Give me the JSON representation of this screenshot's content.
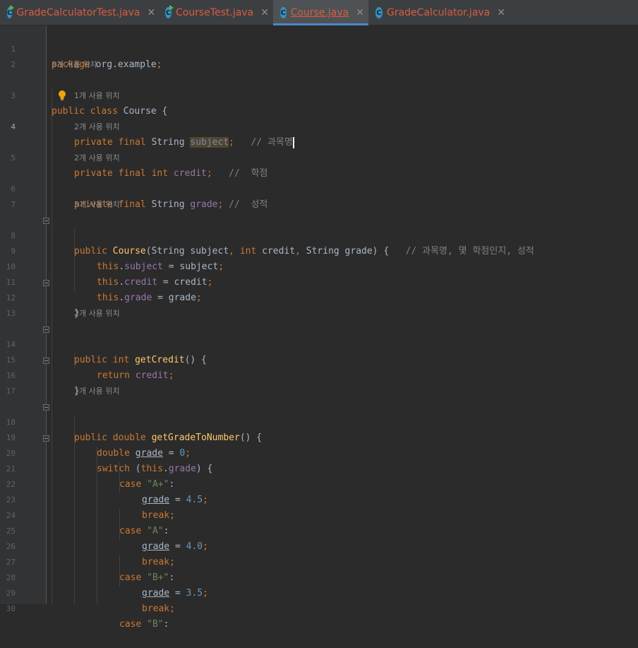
{
  "tabs": [
    {
      "name": "GradeCalculatorTest.java",
      "runnable": true,
      "active": false
    },
    {
      "name": "CourseTest.java",
      "runnable": true,
      "active": false
    },
    {
      "name": "Course.java",
      "runnable": false,
      "active": true
    },
    {
      "name": "GradeCalculator.java",
      "runnable": false,
      "active": false
    }
  ],
  "tab_close_glyph": "✕",
  "file_icon_letter": "C",
  "usage_hints": {
    "h8": "8개 사용 위치",
    "h1": "1개 사용 위치",
    "h2": "2개 사용 위치",
    "h3": "3개 사용 위치"
  },
  "line_numbers": [
    "1",
    "2",
    "3",
    "4",
    "5",
    "6",
    "7",
    "8",
    "9",
    "10",
    "11",
    "12",
    "13",
    "14",
    "15",
    "16",
    "17",
    "18",
    "19",
    "20",
    "21",
    "22",
    "23",
    "24",
    "25",
    "26",
    "27",
    "28",
    "29",
    "30"
  ],
  "code": {
    "l1": {
      "package": "package",
      "name": " org.example",
      "semi": ";"
    },
    "l3": {
      "public": "public",
      "class": " class",
      "name": " Course {"
    },
    "l4": {
      "mods": "private final",
      "type": " String ",
      "field": "subject",
      "semi": ";",
      "comment": "   // 과목명"
    },
    "l5": {
      "mods": "private final int",
      "field": " credit",
      "semi": ";",
      "comment": "   //  학점"
    },
    "l6": {
      "mods": "private final",
      "type": " String ",
      "field": "grade",
      "semi": ";",
      "comment": " //  성적"
    },
    "l8": {
      "public": "public",
      "name": " Course",
      "p1": "(String subject",
      "c1": ",",
      "p2": " int",
      "p3": " credit",
      "c2": ",",
      "p4": " String grade) {",
      "comment": "   // 과목명, 몇 학점인지, 성적"
    },
    "l9": {
      "this": "this",
      "dot": ".",
      "field": "subject",
      "rest": " = subject",
      "semi": ";"
    },
    "l10": {
      "this": "this",
      "dot": ".",
      "field": "credit",
      "rest": " = credit",
      "semi": ";"
    },
    "l11": {
      "this": "this",
      "dot": ".",
      "field": "grade",
      "rest": " = grade",
      "semi": ";"
    },
    "l12": {
      "brace": "}"
    },
    "l14": {
      "kw": "public int",
      "name": " getCredit",
      "rest": "() {"
    },
    "l15": {
      "kw": "return",
      "field": " credit",
      "semi": ";"
    },
    "l16": {
      "brace": "}"
    },
    "l18": {
      "kw": "public double",
      "name": " getGradeToNumber",
      "rest": "() {"
    },
    "l19": {
      "kw": "double ",
      "var": "grade",
      "eq": " = ",
      "num": "0",
      "semi": ";"
    },
    "l20": {
      "kw": "switch",
      "p": " (",
      "this": "this",
      "dot": ".",
      "field": "grade",
      "rest": ") {"
    },
    "l21": {
      "kw": "case ",
      "str": "\"A+\"",
      "colon": ":"
    },
    "l22": {
      "var": "grade",
      "eq": " = ",
      "num": "4.5",
      "semi": ";"
    },
    "l23": {
      "kw": "break",
      "semi": ";"
    },
    "l24": {
      "kw": "case ",
      "str": "\"A\"",
      "colon": ":"
    },
    "l25": {
      "var": "grade",
      "eq": " = ",
      "num": "4.0",
      "semi": ";"
    },
    "l26": {
      "kw": "break",
      "semi": ";"
    },
    "l27": {
      "kw": "case ",
      "str": "\"B+\"",
      "colon": ":"
    },
    "l28": {
      "var": "grade",
      "eq": " = ",
      "num": "3.5",
      "semi": ";"
    },
    "l29": {
      "kw": "break",
      "semi": ";"
    },
    "l30": {
      "kw": "case ",
      "str": "\"B\"",
      "colon": ":"
    }
  },
  "colors": {
    "background": "#2b2b2b",
    "gutter": "#313335",
    "tab_text": "#d95c40",
    "keyword": "#cc7832",
    "field": "#9876aa",
    "string": "#6a8759",
    "number": "#6897bb",
    "method": "#ffc66d",
    "comment": "#808080"
  }
}
